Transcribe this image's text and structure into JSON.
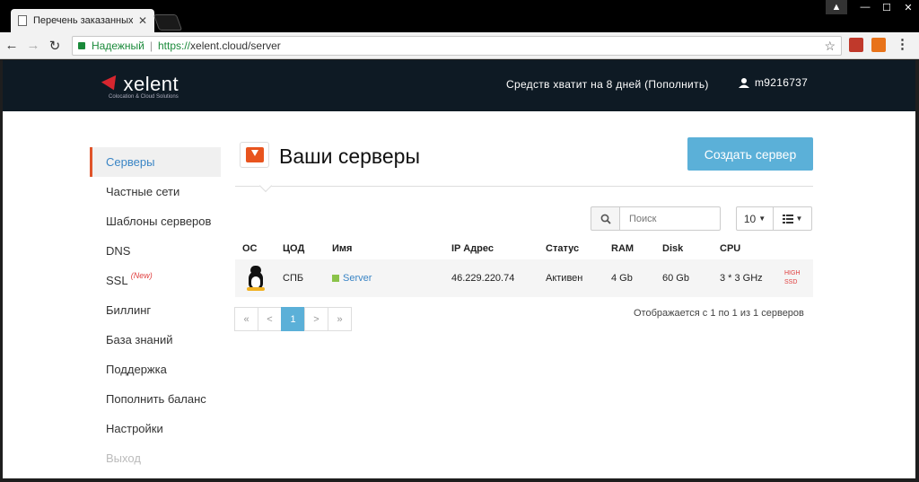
{
  "browser": {
    "tab_title": "Перечень заказанных с",
    "tab_close": "✕",
    "secure_label": "Надежный",
    "url_scheme": "https://",
    "url_rest": "xelent.cloud/server",
    "window_controls": [
      "▲",
      "—",
      "☐",
      "✕"
    ]
  },
  "header": {
    "logo_text": "xelent",
    "logo_sub": "Colocation & Cloud Solutions",
    "balance_text": "Средств хватит на 8 дней (Пополнить)",
    "username": "m9216737"
  },
  "sidebar": {
    "items": [
      {
        "label": "Серверы"
      },
      {
        "label": "Частные сети"
      },
      {
        "label": "Шаблоны серверов"
      },
      {
        "label": "DNS"
      },
      {
        "label": "SSL",
        "badge": "(New)"
      },
      {
        "label": "Биллинг"
      },
      {
        "label": "База знаний"
      },
      {
        "label": "Поддержка"
      },
      {
        "label": "Пополнить баланс"
      },
      {
        "label": "Настройки"
      },
      {
        "label": "Выход"
      }
    ]
  },
  "main": {
    "title": "Ваши серверы",
    "create_button": "Создать сервер",
    "search_placeholder": "Поиск",
    "page_size": "10",
    "table": {
      "columns": [
        "ОС",
        "ЦОД",
        "Имя",
        "IP Адрес",
        "Статус",
        "RAM",
        "Disk",
        "CPU",
        ""
      ],
      "rows": [
        {
          "os": "linux",
          "dc": "СПБ",
          "name": "Server",
          "ip": "46.229.220.74",
          "status": "Активен",
          "ram": "4 Gb",
          "disk": "60 Gb",
          "cpu": "3 * 3 GHz",
          "tag_line1": "HIGH",
          "tag_line2": "SSD"
        }
      ]
    },
    "pager": [
      "«",
      "<",
      "1",
      ">",
      "»"
    ],
    "current_page": "1",
    "showing_text": "Отображается с 1 по 1 из 1 серверов"
  },
  "colors": {
    "header_bg": "#0e1a24",
    "accent": "#5bb0d8",
    "active_border": "#e0542a",
    "link": "#3a85c5"
  }
}
